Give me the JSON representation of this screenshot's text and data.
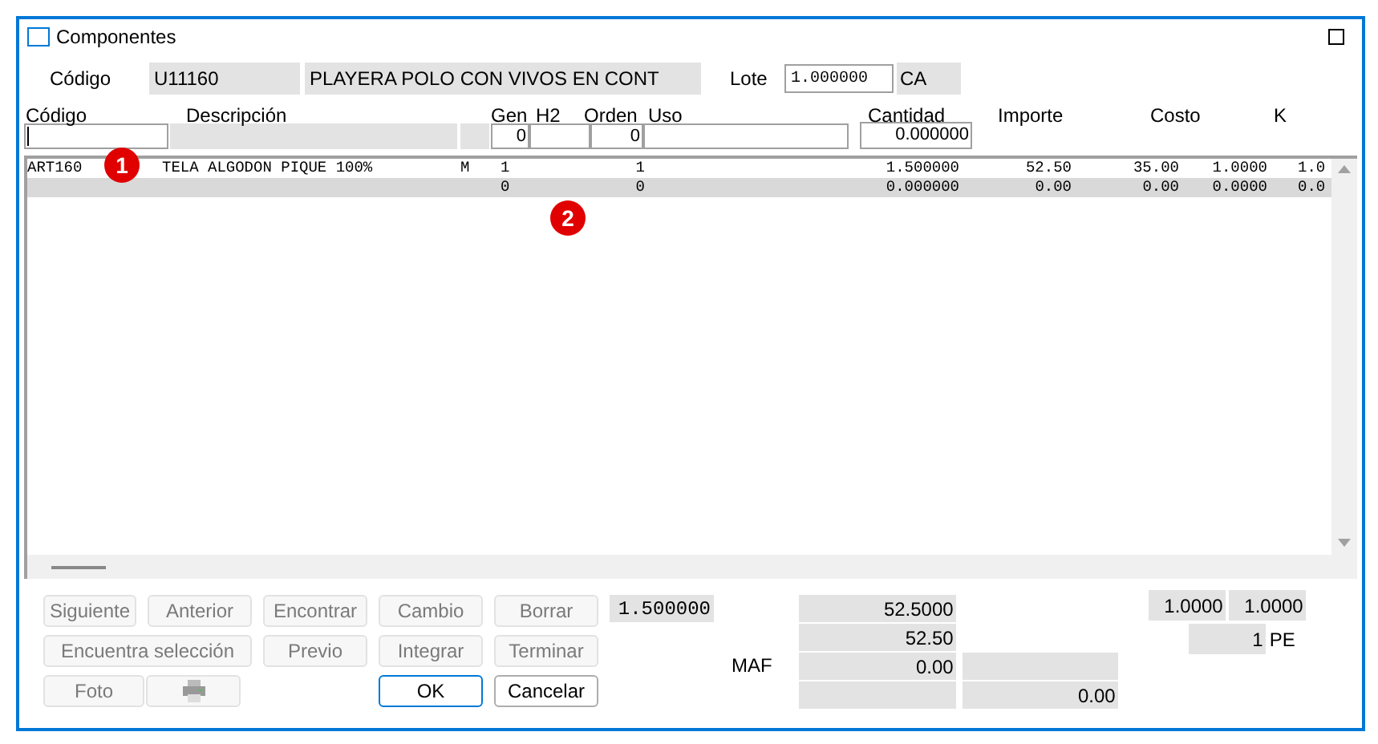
{
  "window": {
    "title": "Componentes"
  },
  "header": {
    "code_label": "Código",
    "code": "U11160",
    "description": "PLAYERA POLO CON VIVOS EN CONT",
    "lot_label": "Lote",
    "lot": "1.000000",
    "unit": "CA"
  },
  "columns": [
    "Código",
    "Descripción",
    "Gen",
    "H2",
    "Orden",
    "Uso",
    "Cantidad",
    "Importe",
    "Costo",
    "K"
  ],
  "entry": {
    "gen": "0",
    "order": "0",
    "quantity": "0.000000"
  },
  "rows": [
    {
      "selected": false,
      "cells": [
        "ART160",
        "TELA ALGODON PIQUE 100%",
        "M",
        "1",
        "1",
        "1.500000",
        "52.50",
        "35.00",
        "1.0000",
        "1.0"
      ]
    },
    {
      "selected": true,
      "cells": [
        "",
        "",
        "",
        "0",
        "0",
        "0.000000",
        "0.00",
        "0.00",
        "0.0000",
        "0.0"
      ]
    }
  ],
  "markers": [
    "1",
    "2"
  ],
  "buttons": [
    {
      "kind": "text",
      "label": "Siguiente",
      "disabled": true
    },
    {
      "kind": "text",
      "label": "Anterior",
      "disabled": true
    },
    {
      "kind": "text",
      "label": "Encontrar",
      "disabled": true
    },
    {
      "kind": "text",
      "label": "Cambio",
      "disabled": true
    },
    {
      "kind": "text",
      "label": "Borrar",
      "disabled": true
    },
    {
      "kind": "text",
      "label": "Encuentra selección",
      "disabled": true
    },
    {
      "kind": "text",
      "label": "Previo",
      "disabled": true
    },
    {
      "kind": "text",
      "label": "Integrar",
      "disabled": true
    },
    {
      "kind": "text",
      "label": "Terminar",
      "disabled": true
    },
    {
      "kind": "text",
      "label": "Foto",
      "disabled": true
    },
    {
      "kind": "printer",
      "disabled": true
    },
    {
      "kind": "text",
      "label": "OK",
      "disabled": false,
      "default": true
    },
    {
      "kind": "text",
      "label": "Cancelar",
      "disabled": false,
      "default": false
    }
  ],
  "summary": {
    "quantity": "1.500000",
    "total_1": "52.5000",
    "total_2": "52.50",
    "maf_label": "MAF",
    "maf": "0.00",
    "total_5": "0.00",
    "factor_1": "1.0000",
    "factor_2": "1.0000",
    "pieces": "1",
    "pieces_unit": "PE"
  }
}
